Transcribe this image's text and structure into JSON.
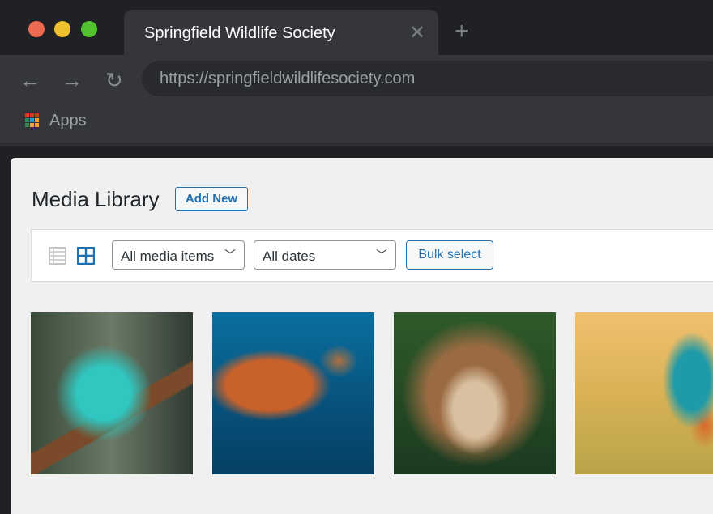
{
  "browser": {
    "tab_title": "Springfield Wildlife Society",
    "url": "https://springfieldwildlifesociety.com",
    "bookmarks": [
      {
        "label": "Apps",
        "icon": "apps-grid-icon"
      }
    ],
    "traffic_lights": [
      "#ec6a4f",
      "#efc12f",
      "#52c22f"
    ]
  },
  "page": {
    "title": "Media Library",
    "add_new_label": "Add New",
    "filters": {
      "view_modes": [
        "list-view-icon",
        "grid-view-icon"
      ],
      "active_view": "grid",
      "media_type": "All media items",
      "date": "All dates",
      "bulk_select_label": "Bulk select"
    },
    "media_items": [
      {
        "subject": "chameleon"
      },
      {
        "subject": "sea turtle"
      },
      {
        "subject": "lion"
      },
      {
        "subject": "kingfisher"
      }
    ],
    "accent_color": "#2271b1"
  }
}
